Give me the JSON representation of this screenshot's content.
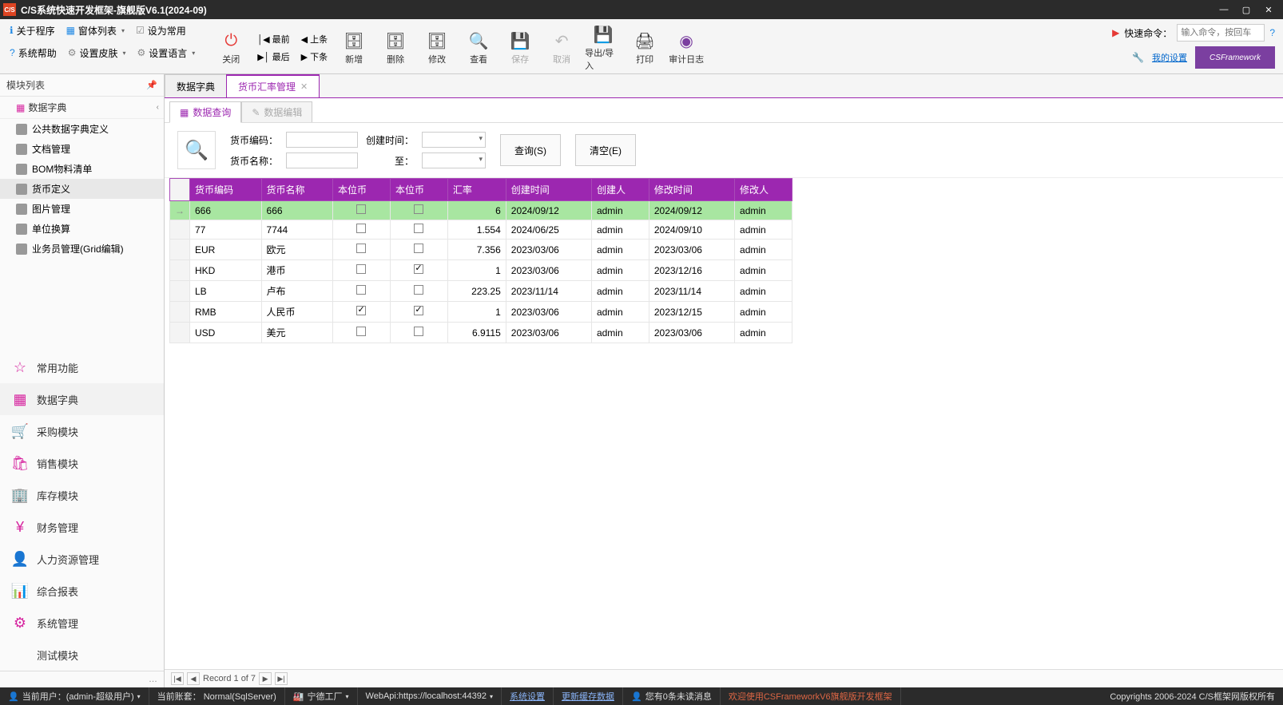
{
  "window": {
    "title": "C/S系统快速开发框架-旗舰版V6.1(2024-09)"
  },
  "topbar": {
    "about": "关于程序",
    "windows": "窗体列表",
    "setdefault": "设为常用",
    "help": "系统帮助",
    "skin": "设置皮肤",
    "lang": "设置语言"
  },
  "bigtools": {
    "close": "关闭",
    "first": "最前",
    "prev": "上条",
    "last": "最后",
    "next": "下条",
    "add": "新增",
    "del": "删除",
    "edit": "修改",
    "view": "查看",
    "save": "保存",
    "cancel": "取消",
    "export": "导出/导入",
    "print": "打印",
    "audit": "审计日志"
  },
  "quickcmd": {
    "label": "快速命令：",
    "placeholder": "输入命令，按回车"
  },
  "mysettings": "我的设置",
  "brand": "CSFramework",
  "sidebar": {
    "header": "模块列表",
    "category": "数据字典",
    "tree": [
      {
        "label": "公共数据字典定义"
      },
      {
        "label": "文档管理"
      },
      {
        "label": "BOM物料清单"
      },
      {
        "label": "货币定义",
        "active": true
      },
      {
        "label": "图片管理"
      },
      {
        "label": "单位换算"
      },
      {
        "label": "业务员管理(Grid编辑)"
      }
    ],
    "modules": [
      {
        "label": "常用功能"
      },
      {
        "label": "数据字典",
        "alt": true
      },
      {
        "label": "采购模块"
      },
      {
        "label": "销售模块"
      },
      {
        "label": "库存模块"
      },
      {
        "label": "财务管理"
      },
      {
        "label": "人力资源管理"
      },
      {
        "label": "综合报表"
      },
      {
        "label": "系统管理"
      },
      {
        "label": "测试模块"
      }
    ],
    "footer": "…"
  },
  "tabs": [
    {
      "label": "数据字典"
    },
    {
      "label": "货币汇率管理",
      "active": true
    }
  ],
  "subtabs": {
    "query": "数据查询",
    "edit": "数据编辑"
  },
  "filter": {
    "code_label": "货币编码：",
    "name_label": "货币名称：",
    "created_label": "创建时间：",
    "to_label": "至：",
    "query_btn": "查询(S)",
    "clear_btn": "清空(E)"
  },
  "grid": {
    "headers": [
      "货币编码",
      "货币名称",
      "本位币",
      "本位币",
      "汇率",
      "创建时间",
      "创建人",
      "修改时间",
      "修改人"
    ],
    "rows": [
      {
        "code": "666",
        "name": "666",
        "b1": false,
        "b2": false,
        "rate": "6",
        "ctime": "2024/09/12",
        "cby": "admin",
        "mtime": "2024/09/12",
        "mby": "admin",
        "sel": true
      },
      {
        "code": "77",
        "name": "7744",
        "b1": false,
        "b2": false,
        "rate": "1.554",
        "ctime": "2024/06/25",
        "cby": "admin",
        "mtime": "2024/09/10",
        "mby": "admin"
      },
      {
        "code": "EUR",
        "name": "欧元",
        "b1": false,
        "b2": false,
        "rate": "7.356",
        "ctime": "2023/03/06",
        "cby": "admin",
        "mtime": "2023/03/06",
        "mby": "admin"
      },
      {
        "code": "HKD",
        "name": "港币",
        "b1": false,
        "b2": true,
        "rate": "1",
        "ctime": "2023/03/06",
        "cby": "admin",
        "mtime": "2023/12/16",
        "mby": "admin"
      },
      {
        "code": "LB",
        "name": "卢布",
        "b1": false,
        "b2": false,
        "rate": "223.25",
        "ctime": "2023/11/14",
        "cby": "admin",
        "mtime": "2023/11/14",
        "mby": "admin"
      },
      {
        "code": "RMB",
        "name": "人民币",
        "b1": true,
        "b2": true,
        "rate": "1",
        "ctime": "2023/03/06",
        "cby": "admin",
        "mtime": "2023/12/15",
        "mby": "admin"
      },
      {
        "code": "USD",
        "name": "美元",
        "b1": false,
        "b2": false,
        "rate": "6.9115",
        "ctime": "2023/03/06",
        "cby": "admin",
        "mtime": "2023/03/06",
        "mby": "admin"
      }
    ]
  },
  "pager": {
    "text": "Record 1 of 7"
  },
  "status": {
    "user": "当前用户：(admin-超级用户)",
    "account": "当前账套： Normal(SqlServer)",
    "factory": "宁德工厂",
    "webapi": "WebApi:https://localhost:44392",
    "syscfg": "系统设置",
    "refresh": "更新缓存数据",
    "msgs": "您有0条未读消息",
    "welcome": "欢迎使用CSFrameworkV6旗舰版开发框架",
    "copy": "Copyrights 2006-2024 C/S框架网版权所有"
  }
}
